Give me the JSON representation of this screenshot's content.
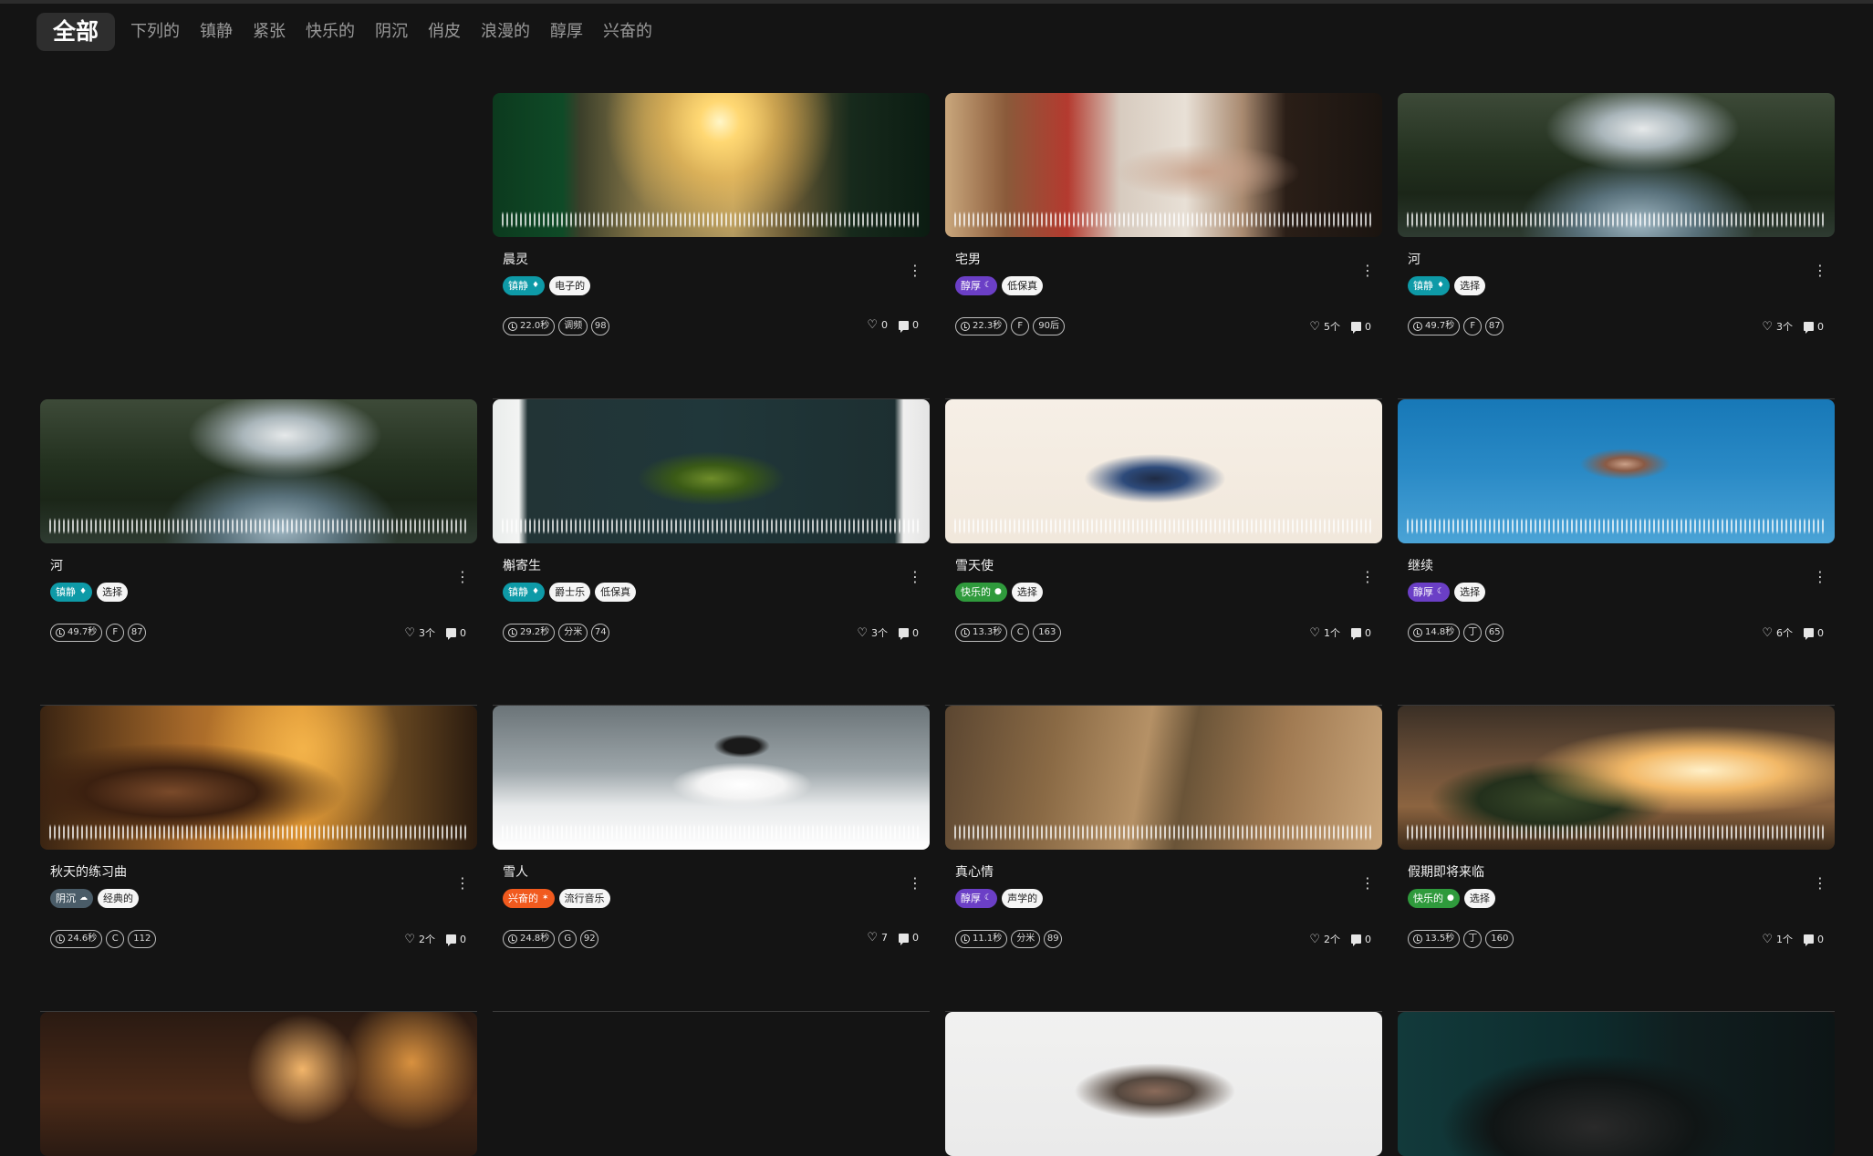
{
  "filters": {
    "items": [
      "全部",
      "下列的",
      "镇静",
      "紧张",
      "快乐的",
      "阴沉",
      "俏皮",
      "浪漫的",
      "醇厚",
      "兴奋的"
    ]
  },
  "tag_colors": {
    "镇静": "#0e9aa7",
    "醇厚": "#6b3fc6",
    "快乐的": "#2f9a3c",
    "阴沉": "#4a5c68",
    "兴奋的": "#f15a1e"
  },
  "cards": [
    {
      "title": "晨灵",
      "tags": [
        {
          "label": "镇静",
          "type": "mood",
          "icon": "♦"
        },
        {
          "label": "电子的",
          "type": "genre"
        }
      ],
      "meta": {
        "duration": "22.0秒",
        "key": "调频",
        "tempo": "98"
      },
      "likes": "0",
      "comments": "0"
    },
    {
      "title": "宅男",
      "tags": [
        {
          "label": "醇厚",
          "type": "mood",
          "icon": "☾"
        },
        {
          "label": "低保真",
          "type": "genre"
        }
      ],
      "meta": {
        "duration": "22.3秒",
        "key": "F",
        "tempo": "90后"
      },
      "likes": "5个",
      "comments": "0"
    },
    {
      "title": "河",
      "tags": [
        {
          "label": "镇静",
          "type": "mood",
          "icon": "♦"
        },
        {
          "label": "选择",
          "type": "genre"
        }
      ],
      "meta": {
        "duration": "49.7秒",
        "key": "F",
        "tempo": "87"
      },
      "likes": "3个",
      "comments": "0"
    },
    {
      "title": "河",
      "tags": [
        {
          "label": "镇静",
          "type": "mood",
          "icon": "♦"
        },
        {
          "label": "选择",
          "type": "genre"
        }
      ],
      "meta": {
        "duration": "49.7秒",
        "key": "F",
        "tempo": "87"
      },
      "likes": "3个",
      "comments": "0"
    },
    {
      "title": "槲寄生",
      "tags": [
        {
          "label": "镇静",
          "type": "mood",
          "icon": "♦"
        },
        {
          "label": "爵士乐",
          "type": "genre"
        },
        {
          "label": "低保真",
          "type": "genre"
        }
      ],
      "meta": {
        "duration": "29.2秒",
        "key": "分米",
        "tempo": "74"
      },
      "likes": "3个",
      "comments": "0"
    },
    {
      "title": "雪天使",
      "tags": [
        {
          "label": "快乐的",
          "type": "mood",
          "icon": "●"
        },
        {
          "label": "选择",
          "type": "genre"
        }
      ],
      "meta": {
        "duration": "13.3秒",
        "key": "C",
        "tempo": "163"
      },
      "likes": "1个",
      "comments": "0"
    },
    {
      "title": "继续",
      "tags": [
        {
          "label": "醇厚",
          "type": "mood",
          "icon": "☾"
        },
        {
          "label": "选择",
          "type": "genre"
        }
      ],
      "meta": {
        "duration": "14.8秒",
        "key": "丁",
        "tempo": "65"
      },
      "likes": "6个",
      "comments": "0"
    },
    {
      "title": "秋天的练习曲",
      "tags": [
        {
          "label": "阴沉",
          "type": "mood",
          "icon": "☁"
        },
        {
          "label": "经典的",
          "type": "genre"
        }
      ],
      "meta": {
        "duration": "24.6秒",
        "key": "C",
        "tempo": "112"
      },
      "likes": "2个",
      "comments": "0"
    },
    {
      "title": "雪人",
      "tags": [
        {
          "label": "兴奋的",
          "type": "mood",
          "icon": "✶"
        },
        {
          "label": "流行音乐",
          "type": "genre"
        }
      ],
      "meta": {
        "duration": "24.8秒",
        "key": "G",
        "tempo": "92"
      },
      "likes": "7",
      "comments": "0"
    },
    {
      "title": "真心情",
      "tags": [
        {
          "label": "醇厚",
          "type": "mood",
          "icon": "☾"
        },
        {
          "label": "声学的",
          "type": "genre"
        }
      ],
      "meta": {
        "duration": "11.1秒",
        "key": "分米",
        "tempo": "89"
      },
      "likes": "2个",
      "comments": "0"
    },
    {
      "title": "假期即将来临",
      "tags": [
        {
          "label": "快乐的",
          "type": "mood",
          "icon": "●"
        },
        {
          "label": "选择",
          "type": "genre"
        }
      ],
      "meta": {
        "duration": "13.5秒",
        "key": "丁",
        "tempo": "160"
      },
      "likes": "1个",
      "comments": "0"
    }
  ]
}
